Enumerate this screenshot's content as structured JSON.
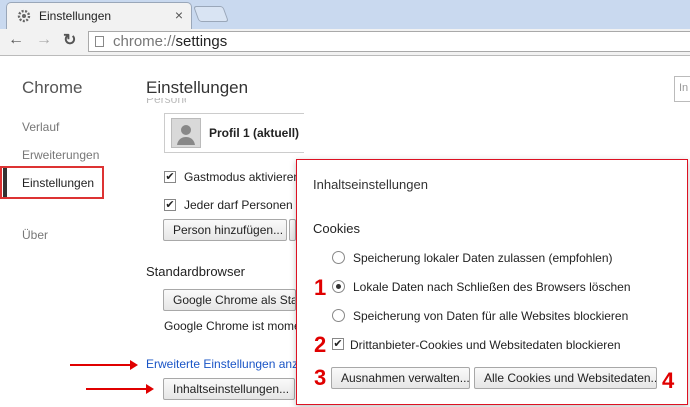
{
  "tab": {
    "title": "Einstellungen",
    "close": "×"
  },
  "toolbar": {
    "back": "←",
    "forward": "→",
    "reload": "↻",
    "url_scheme": "chrome://",
    "url_path": "settings"
  },
  "sidebar": {
    "title": "Chrome",
    "items": [
      {
        "label": "Verlauf"
      },
      {
        "label": "Erweiterungen"
      },
      {
        "label": "Einstellungen"
      },
      {
        "label": "Über"
      }
    ]
  },
  "main": {
    "title": "Einstellungen",
    "search_placeholder": "In",
    "section_personal": "Personen",
    "profile_name": "Profil 1 (aktuell)",
    "guest_label": "Gastmodus aktivieren",
    "anyone_label": "Jeder darf Personen zu",
    "add_person_button": "Person hinzufügen...",
    "section_default": "Standardbrowser",
    "default_button": "Google Chrome als Stan",
    "default_status": "Google Chrome ist momer",
    "advanced_link": "Erweiterte Einstellungen anzei",
    "content_settings_button": "Inhaltseinstellungen..."
  },
  "dialog": {
    "title": "Inhaltseinstellungen",
    "section": "Cookies",
    "options": [
      {
        "label": "Speicherung lokaler Daten zulassen (empfohlen)",
        "selected": false
      },
      {
        "label": "Lokale Daten nach Schließen des Browsers löschen",
        "selected": true
      },
      {
        "label": "Speicherung von Daten für alle Websites blockieren",
        "selected": false
      }
    ],
    "third_party_label": "Drittanbieter-Cookies und Websitedaten blockieren",
    "third_party_checked": true,
    "exceptions_button": "Ausnahmen verwalten...",
    "all_cookies_button": "Alle Cookies und Websitedaten..."
  },
  "annotations": {
    "n1": "1",
    "n2": "2",
    "n3": "3",
    "n4": "4",
    "color": "#e00000"
  },
  "colors": {
    "accent_link": "#1a55c6",
    "tabstrip": "#c9d9ef"
  }
}
